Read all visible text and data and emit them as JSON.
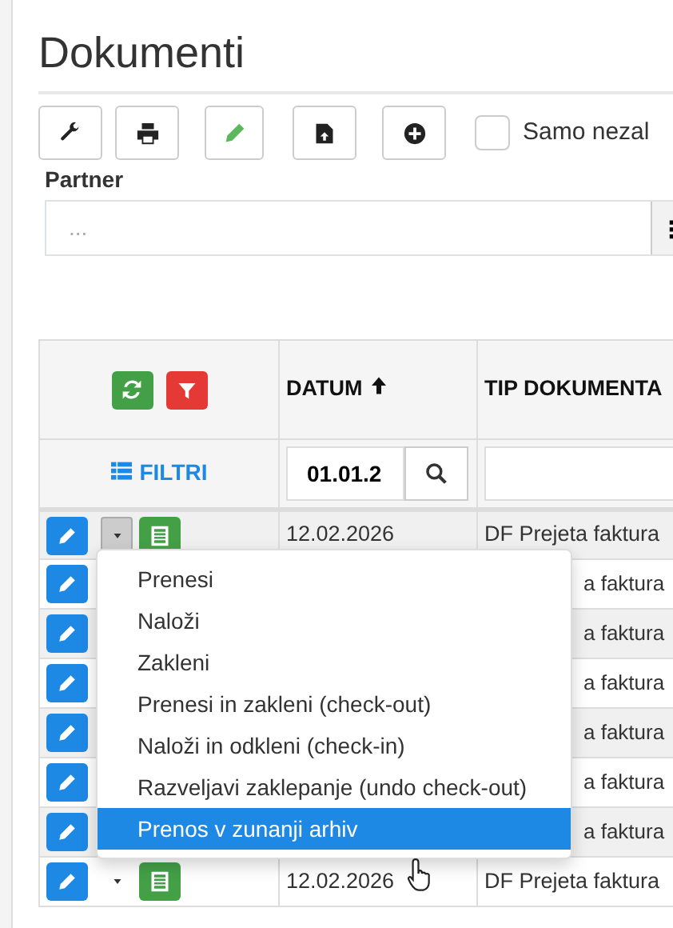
{
  "page": {
    "title": "Dokumenti"
  },
  "toolbar": {
    "buttons": [
      {
        "kind": "wrench"
      },
      {
        "kind": "print"
      },
      {
        "kind": "pencil"
      },
      {
        "kind": "upload"
      },
      {
        "kind": "plus"
      }
    ],
    "checkbox": {
      "label": "Samo nezal",
      "checked": false
    }
  },
  "partner": {
    "label": "Partner",
    "placeholder": "..."
  },
  "table": {
    "columns": [
      {
        "label": "DATUM",
        "sorted": true
      },
      {
        "label": "TIP DOKUMENTA",
        "sorted": false
      }
    ],
    "filter_label": "FILTRI",
    "date_filter": "01.01.2",
    "rows": [
      {
        "kind": "full",
        "date": "12.02.2026",
        "type": "DF Prejeta faktura",
        "expanded": true
      },
      {
        "kind": "partial",
        "type": "a faktura"
      },
      {
        "kind": "partial",
        "type": "a faktura"
      },
      {
        "kind": "partial",
        "type": "a faktura"
      },
      {
        "kind": "partial",
        "type": "a faktura"
      },
      {
        "kind": "partial",
        "type": "a faktura"
      },
      {
        "kind": "partial",
        "type": "a faktura"
      },
      {
        "kind": "full",
        "date": "12.02.2026",
        "type": "DF Prejeta faktura",
        "expanded": false
      }
    ]
  },
  "context_menu": {
    "items": [
      {
        "label": "Prenesi",
        "selected": false
      },
      {
        "label": "Naloži",
        "selected": false
      },
      {
        "label": "Zakleni",
        "selected": false
      },
      {
        "label": "Prenesi in zakleni (check-out)",
        "selected": false
      },
      {
        "label": "Naloži in odkleni (check-in)",
        "selected": false
      },
      {
        "label": "Razveljavi zaklepanje (undo check-out)",
        "selected": false
      },
      {
        "label": "Prenos v zunanji arhiv",
        "selected": true
      }
    ]
  }
}
